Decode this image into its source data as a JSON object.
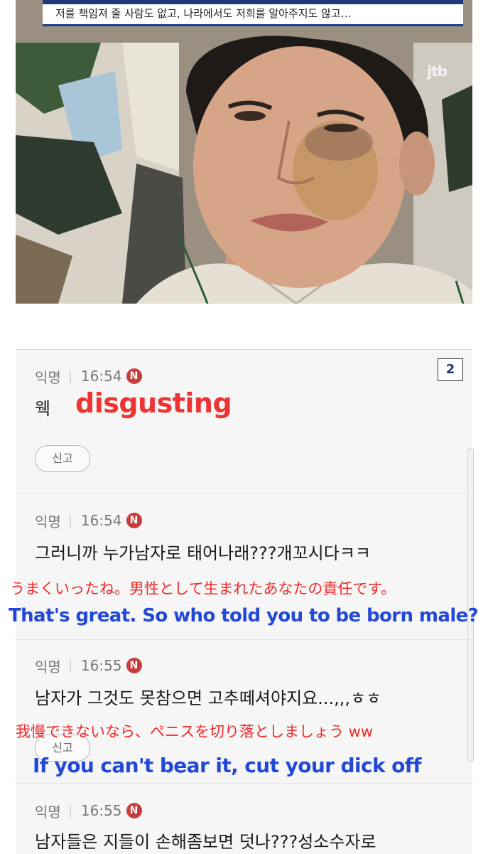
{
  "video": {
    "subtitle": "저를 책임져 줄 사람도 없고, 나라에서도 저희를 알아주지도 않고…",
    "channel_logo": "jtb",
    "colors": {
      "subtitle_bar_accent": "#1b3f8b"
    }
  },
  "page_badge": "2",
  "comments": [
    {
      "author": "익명",
      "separator": "|",
      "time": "16:54",
      "badge": "N",
      "text": "웩",
      "overlay_en": "disgusting",
      "report_label": "신고"
    },
    {
      "author": "익명",
      "separator": "|",
      "time": "16:54",
      "badge": "N",
      "text": "그러니까 누가남자로 태어나래???개꼬시다ㅋㅋ",
      "overlay_jp": "うまくいったね。男性として生まれたあなたの責任です。",
      "overlay_en": "That's great. So who told you to be born male?"
    },
    {
      "author": "익명",
      "separator": "|",
      "time": "16:55",
      "badge": "N",
      "text": "남자가 그것도 못참으면 고추떼셔야지요...,,,ㅎㅎ",
      "overlay_jp": "我慢できないなら、ペニスを切り落としましょう ww",
      "overlay_en": "If you can't bear it, cut your dick off",
      "report_label": "신고"
    },
    {
      "author": "익명",
      "separator": "|",
      "time": "16:55",
      "badge": "N",
      "text": "남자들은 지들이 손해좀보면 덧나???성소수자로"
    }
  ],
  "colors": {
    "new_badge": "#c83c3c",
    "overlay_red": "#ee3333",
    "overlay_blue": "#2249d6"
  }
}
